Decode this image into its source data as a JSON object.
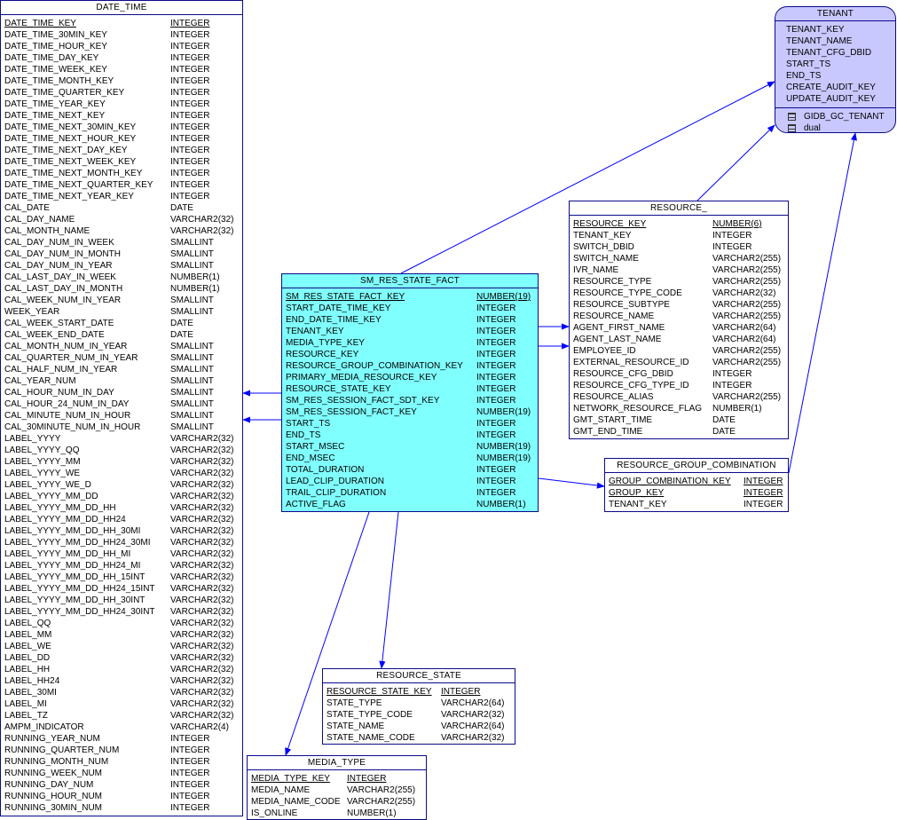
{
  "entities": {
    "date_time": {
      "name": "DATE_TIME",
      "columns": [
        [
          "DATE_TIME_KEY",
          "INTEGER",
          true
        ],
        [
          "DATE_TIME_30MIN_KEY",
          "INTEGER",
          false
        ],
        [
          "DATE_TIME_HOUR_KEY",
          "INTEGER",
          false
        ],
        [
          "DATE_TIME_DAY_KEY",
          "INTEGER",
          false
        ],
        [
          "DATE_TIME_WEEK_KEY",
          "INTEGER",
          false
        ],
        [
          "DATE_TIME_MONTH_KEY",
          "INTEGER",
          false
        ],
        [
          "DATE_TIME_QUARTER_KEY",
          "INTEGER",
          false
        ],
        [
          "DATE_TIME_YEAR_KEY",
          "INTEGER",
          false
        ],
        [
          "DATE_TIME_NEXT_KEY",
          "INTEGER",
          false
        ],
        [
          "DATE_TIME_NEXT_30MIN_KEY",
          "INTEGER",
          false
        ],
        [
          "DATE_TIME_NEXT_HOUR_KEY",
          "INTEGER",
          false
        ],
        [
          "DATE_TIME_NEXT_DAY_KEY",
          "INTEGER",
          false
        ],
        [
          "DATE_TIME_NEXT_WEEK_KEY",
          "INTEGER",
          false
        ],
        [
          "DATE_TIME_NEXT_MONTH_KEY",
          "INTEGER",
          false
        ],
        [
          "DATE_TIME_NEXT_QUARTER_KEY",
          "INTEGER",
          false
        ],
        [
          "DATE_TIME_NEXT_YEAR_KEY",
          "INTEGER",
          false
        ],
        [
          "CAL_DATE",
          "DATE",
          false
        ],
        [
          "CAL_DAY_NAME",
          "VARCHAR2(32)",
          false
        ],
        [
          "CAL_MONTH_NAME",
          "VARCHAR2(32)",
          false
        ],
        [
          "CAL_DAY_NUM_IN_WEEK",
          "SMALLINT",
          false
        ],
        [
          "CAL_DAY_NUM_IN_MONTH",
          "SMALLINT",
          false
        ],
        [
          "CAL_DAY_NUM_IN_YEAR",
          "SMALLINT",
          false
        ],
        [
          "CAL_LAST_DAY_IN_WEEK",
          "NUMBER(1)",
          false
        ],
        [
          "CAL_LAST_DAY_IN_MONTH",
          "NUMBER(1)",
          false
        ],
        [
          "CAL_WEEK_NUM_IN_YEAR",
          "SMALLINT",
          false
        ],
        [
          "WEEK_YEAR",
          "SMALLINT",
          false
        ],
        [
          "CAL_WEEK_START_DATE",
          "DATE",
          false
        ],
        [
          "CAL_WEEK_END_DATE",
          "DATE",
          false
        ],
        [
          "CAL_MONTH_NUM_IN_YEAR",
          "SMALLINT",
          false
        ],
        [
          "CAL_QUARTER_NUM_IN_YEAR",
          "SMALLINT",
          false
        ],
        [
          "CAL_HALF_NUM_IN_YEAR",
          "SMALLINT",
          false
        ],
        [
          "CAL_YEAR_NUM",
          "SMALLINT",
          false
        ],
        [
          "CAL_HOUR_NUM_IN_DAY",
          "SMALLINT",
          false
        ],
        [
          "CAL_HOUR_24_NUM_IN_DAY",
          "SMALLINT",
          false
        ],
        [
          "CAL_MINUTE_NUM_IN_HOUR",
          "SMALLINT",
          false
        ],
        [
          "CAL_30MINUTE_NUM_IN_HOUR",
          "SMALLINT",
          false
        ],
        [
          "LABEL_YYYY",
          "VARCHAR2(32)",
          false
        ],
        [
          "LABEL_YYYY_QQ",
          "VARCHAR2(32)",
          false
        ],
        [
          "LABEL_YYYY_MM",
          "VARCHAR2(32)",
          false
        ],
        [
          "LABEL_YYYY_WE",
          "VARCHAR2(32)",
          false
        ],
        [
          "LABEL_YYYY_WE_D",
          "VARCHAR2(32)",
          false
        ],
        [
          "LABEL_YYYY_MM_DD",
          "VARCHAR2(32)",
          false
        ],
        [
          "LABEL_YYYY_MM_DD_HH",
          "VARCHAR2(32)",
          false
        ],
        [
          "LABEL_YYYY_MM_DD_HH24",
          "VARCHAR2(32)",
          false
        ],
        [
          "LABEL_YYYY_MM_DD_HH_30MI",
          "VARCHAR2(32)",
          false
        ],
        [
          "LABEL_YYYY_MM_DD_HH24_30MI",
          "VARCHAR2(32)",
          false
        ],
        [
          "LABEL_YYYY_MM_DD_HH_MI",
          "VARCHAR2(32)",
          false
        ],
        [
          "LABEL_YYYY_MM_DD_HH24_MI",
          "VARCHAR2(32)",
          false
        ],
        [
          "LABEL_YYYY_MM_DD_HH_15INT",
          "VARCHAR2(32)",
          false
        ],
        [
          "LABEL_YYYY_MM_DD_HH24_15INT",
          "VARCHAR2(32)",
          false
        ],
        [
          "LABEL_YYYY_MM_DD_HH_30INT",
          "VARCHAR2(32)",
          false
        ],
        [
          "LABEL_YYYY_MM_DD_HH24_30INT",
          "VARCHAR2(32)",
          false
        ],
        [
          "LABEL_QQ",
          "VARCHAR2(32)",
          false
        ],
        [
          "LABEL_MM",
          "VARCHAR2(32)",
          false
        ],
        [
          "LABEL_WE",
          "VARCHAR2(32)",
          false
        ],
        [
          "LABEL_DD",
          "VARCHAR2(32)",
          false
        ],
        [
          "LABEL_HH",
          "VARCHAR2(32)",
          false
        ],
        [
          "LABEL_HH24",
          "VARCHAR2(32)",
          false
        ],
        [
          "LABEL_30MI",
          "VARCHAR2(32)",
          false
        ],
        [
          "LABEL_MI",
          "VARCHAR2(32)",
          false
        ],
        [
          "LABEL_TZ",
          "VARCHAR2(32)",
          false
        ],
        [
          "AMPM_INDICATOR",
          "VARCHAR2(4)",
          false
        ],
        [
          "RUNNING_YEAR_NUM",
          "INTEGER",
          false
        ],
        [
          "RUNNING_QUARTER_NUM",
          "INTEGER",
          false
        ],
        [
          "RUNNING_MONTH_NUM",
          "INTEGER",
          false
        ],
        [
          "RUNNING_WEEK_NUM",
          "INTEGER",
          false
        ],
        [
          "RUNNING_DAY_NUM",
          "INTEGER",
          false
        ],
        [
          "RUNNING_HOUR_NUM",
          "INTEGER",
          false
        ],
        [
          "RUNNING_30MIN_NUM",
          "INTEGER",
          false
        ]
      ]
    },
    "sm_res_state_fact": {
      "name": "SM_RES_STATE_FACT",
      "columns": [
        [
          "SM_RES_STATE_FACT_KEY",
          "NUMBER(19)",
          true
        ],
        [
          "START_DATE_TIME_KEY",
          "INTEGER",
          false
        ],
        [
          "END_DATE_TIME_KEY",
          "INTEGER",
          false
        ],
        [
          "TENANT_KEY",
          "INTEGER",
          false
        ],
        [
          "MEDIA_TYPE_KEY",
          "INTEGER",
          false
        ],
        [
          "RESOURCE_KEY",
          "INTEGER",
          false
        ],
        [
          "RESOURCE_GROUP_COMBINATION_KEY",
          "INTEGER",
          false
        ],
        [
          "PRIMARY_MEDIA_RESOURCE_KEY",
          "INTEGER",
          false
        ],
        [
          "RESOURCE_STATE_KEY",
          "INTEGER",
          false
        ],
        [
          "SM_RES_SESSION_FACT_SDT_KEY",
          "INTEGER",
          false
        ],
        [
          "SM_RES_SESSION_FACT_KEY",
          "NUMBER(19)",
          false
        ],
        [
          "START_TS",
          "INTEGER",
          false
        ],
        [
          "END_TS",
          "INTEGER",
          false
        ],
        [
          "START_MSEC",
          "NUMBER(19)",
          false
        ],
        [
          "END_MSEC",
          "NUMBER(19)",
          false
        ],
        [
          "TOTAL_DURATION",
          "INTEGER",
          false
        ],
        [
          "LEAD_CLIP_DURATION",
          "INTEGER",
          false
        ],
        [
          "TRAIL_CLIP_DURATION",
          "INTEGER",
          false
        ],
        [
          "ACTIVE_FLAG",
          "NUMBER(1)",
          false
        ]
      ]
    },
    "resource": {
      "name": "RESOURCE_",
      "columns": [
        [
          "RESOURCE_KEY",
          "NUMBER(6)",
          true
        ],
        [
          "TENANT_KEY",
          "INTEGER",
          false
        ],
        [
          "SWITCH_DBID",
          "INTEGER",
          false
        ],
        [
          "SWITCH_NAME",
          "VARCHAR2(255)",
          false
        ],
        [
          "IVR_NAME",
          "VARCHAR2(255)",
          false
        ],
        [
          "RESOURCE_TYPE",
          "VARCHAR2(255)",
          false
        ],
        [
          "RESOURCE_TYPE_CODE",
          "VARCHAR2(32)",
          false
        ],
        [
          "RESOURCE_SUBTYPE",
          "VARCHAR2(255)",
          false
        ],
        [
          "RESOURCE_NAME",
          "VARCHAR2(255)",
          false
        ],
        [
          "AGENT_FIRST_NAME",
          "VARCHAR2(64)",
          false
        ],
        [
          "AGENT_LAST_NAME",
          "VARCHAR2(64)",
          false
        ],
        [
          "EMPLOYEE_ID",
          "VARCHAR2(255)",
          false
        ],
        [
          "EXTERNAL_RESOURCE_ID",
          "VARCHAR2(255)",
          false
        ],
        [
          "RESOURCE_CFG_DBID",
          "INTEGER",
          false
        ],
        [
          "RESOURCE_CFG_TYPE_ID",
          "INTEGER",
          false
        ],
        [
          "RESOURCE_ALIAS",
          "VARCHAR2(255)",
          false
        ],
        [
          "NETWORK_RESOURCE_FLAG",
          "NUMBER(1)",
          false
        ],
        [
          "GMT_START_TIME",
          "DATE",
          false
        ],
        [
          "GMT_END_TIME",
          "DATE",
          false
        ]
      ]
    },
    "resource_group_combination": {
      "name": "RESOURCE_GROUP_COMBINATION",
      "columns": [
        [
          "GROUP_COMBINATION_KEY",
          "INTEGER",
          true
        ],
        [
          "GROUP_KEY",
          "INTEGER",
          true
        ],
        [
          "TENANT_KEY",
          "INTEGER",
          false
        ]
      ]
    },
    "resource_state": {
      "name": "RESOURCE_STATE",
      "columns": [
        [
          "RESOURCE_STATE_KEY",
          "INTEGER",
          true
        ],
        [
          "STATE_TYPE",
          "VARCHAR2(64)",
          false
        ],
        [
          "STATE_TYPE_CODE",
          "VARCHAR2(32)",
          false
        ],
        [
          "STATE_NAME",
          "VARCHAR2(64)",
          false
        ],
        [
          "STATE_NAME_CODE",
          "VARCHAR2(32)",
          false
        ]
      ]
    },
    "media_type": {
      "name": "MEDIA_TYPE",
      "columns": [
        [
          "MEDIA_TYPE_KEY",
          "INTEGER",
          true
        ],
        [
          "MEDIA_NAME",
          "VARCHAR2(255)",
          false
        ],
        [
          "MEDIA_NAME_CODE",
          "VARCHAR2(255)",
          false
        ],
        [
          "IS_ONLINE",
          "NUMBER(1)",
          false
        ]
      ]
    },
    "tenant": {
      "name": "TENANT",
      "columns": [
        "TENANT_KEY",
        "TENANT_NAME",
        "TENANT_CFG_DBID",
        "START_TS",
        "END_TS",
        "CREATE_AUDIT_KEY",
        "UPDATE_AUDIT_KEY"
      ],
      "references": [
        "GIDB_GC_TENANT",
        "dual"
      ]
    }
  },
  "colors": {
    "border": "#0a0a8a",
    "link": "#0000ff",
    "fact_fill": "#80ffff",
    "tenant_fill": "#c8c8ff"
  }
}
